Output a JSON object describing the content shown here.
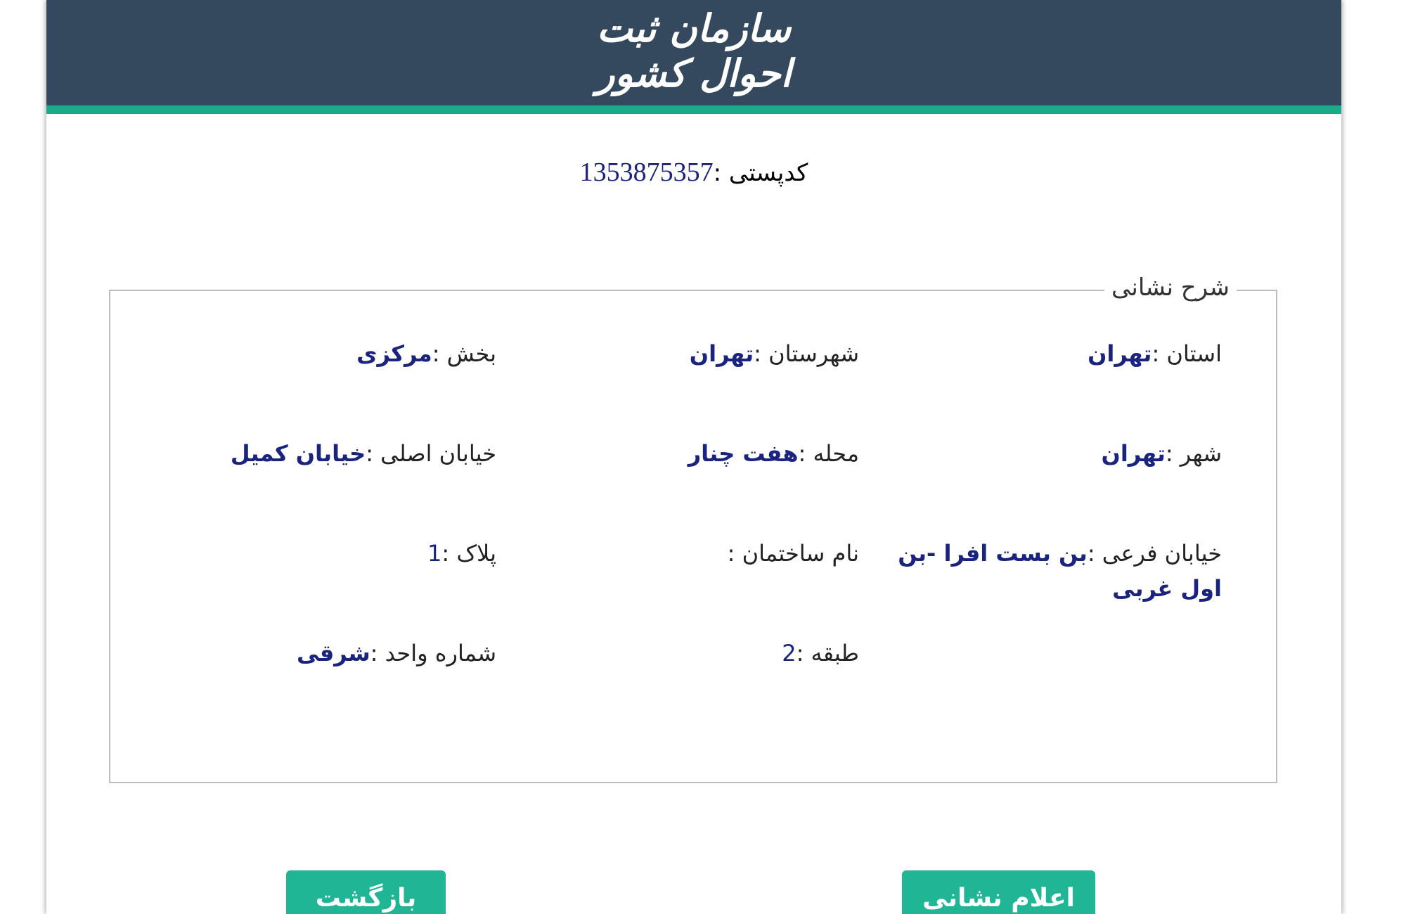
{
  "header": {
    "logo_text": "سازمان ثبت احوال کشور",
    "background_color": "#34495e",
    "accent_color": "#1aab8a"
  },
  "postal_code": {
    "label": "کدپستی :",
    "value": "1353875357"
  },
  "address": {
    "legend": "شرح نشانی",
    "fields": {
      "province": {
        "label": "استان :",
        "value": "تهران"
      },
      "county": {
        "label": "شهرستان :",
        "value": "تهران"
      },
      "district": {
        "label": "بخش :",
        "value": "مرکزی"
      },
      "city": {
        "label": "شهر :",
        "value": "تهران"
      },
      "neighborhood": {
        "label": "محله :",
        "value": "هفت چنار"
      },
      "main_street": {
        "label": "خیابان اصلی :",
        "value": "خیابان کمیل"
      },
      "side_street": {
        "label": "خیابان فرعی :",
        "value": "بن بست افرا -بن اول غربی"
      },
      "building_name": {
        "label": "نام ساختمان :",
        "value": ""
      },
      "plaque": {
        "label": "پلاک :",
        "value": "1"
      },
      "floor": {
        "label": "طبقه :",
        "value": "2"
      },
      "unit": {
        "label": "شماره واحد :",
        "value": "شرقی"
      }
    }
  },
  "buttons": {
    "declare_label": "اعلام نشانی",
    "back_label": "بازگشت",
    "color": "#1fb595"
  }
}
